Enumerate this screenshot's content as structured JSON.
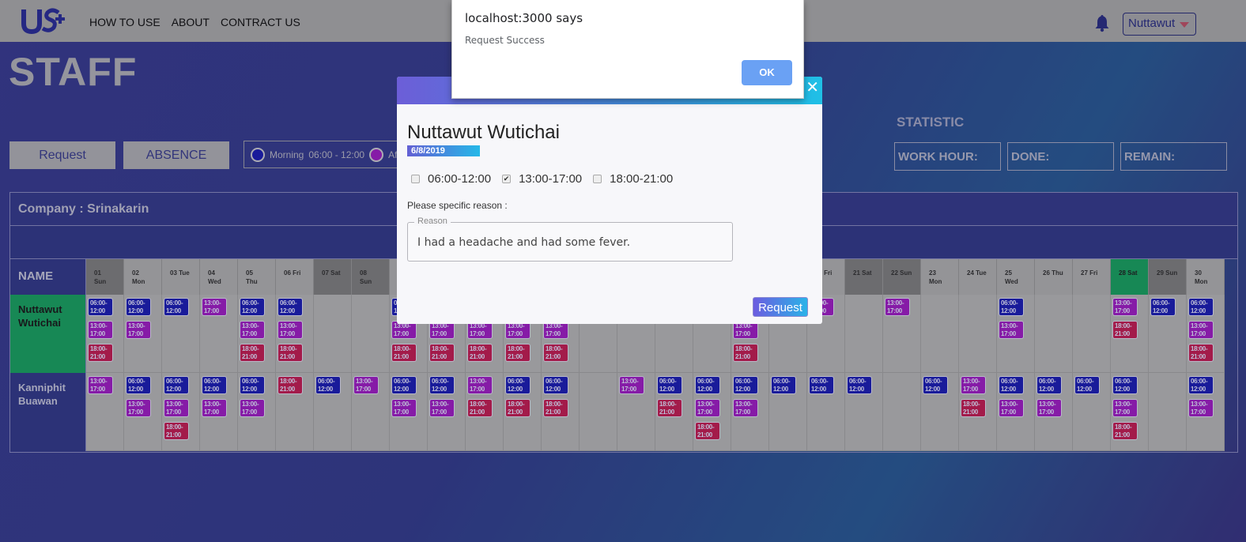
{
  "header": {
    "nav": [
      "HOW TO USE",
      "ABOUT",
      "CONTRACT US"
    ],
    "user": "Nuttawut"
  },
  "page_title": "STAFF",
  "actions": {
    "request": "Request",
    "absence": "ABSENCE"
  },
  "legend": {
    "morning": "Morning",
    "morning_time": "06:00 - 12:00",
    "afternoon_partial": "Afte"
  },
  "statistic": {
    "title": "STATISTIC",
    "boxes": [
      "WORK HOUR:",
      "DONE:",
      "REMAIN:"
    ]
  },
  "schedule": {
    "company": "Company : Srinakarin",
    "name_header": "NAME",
    "staff": [
      {
        "name": "Nuttawut Wutichai",
        "color": "#1aa462",
        "text_color": "#1b1b1b"
      },
      {
        "name": "Kanniphit Buawan",
        "color": "#343b8c",
        "text_color": "#c7c8de"
      }
    ],
    "chip_labels": {
      "m": "06:00-12:00",
      "a": "13:00-17:00",
      "e": "18:00-21:00"
    },
    "chip_colors": {
      "m": "#1d1fb6",
      "a": "#a11fc6",
      "e": "#c51f55"
    }
  },
  "modal": {
    "name": "Nuttawut Wutichai",
    "date": "6/8/2019",
    "options": [
      {
        "label": "06:00-12:00",
        "checked": false
      },
      {
        "label": "13:00-17:00",
        "checked": true
      },
      {
        "label": "18:00-21:00",
        "checked": false
      }
    ],
    "hint": "Please specific reason :",
    "reason_label": "Reason",
    "reason_value": "I had a headache and had some fever.",
    "submit": "Request"
  },
  "alert": {
    "title": "localhost:3000 says",
    "message": "Request Success",
    "ok": "OK"
  }
}
